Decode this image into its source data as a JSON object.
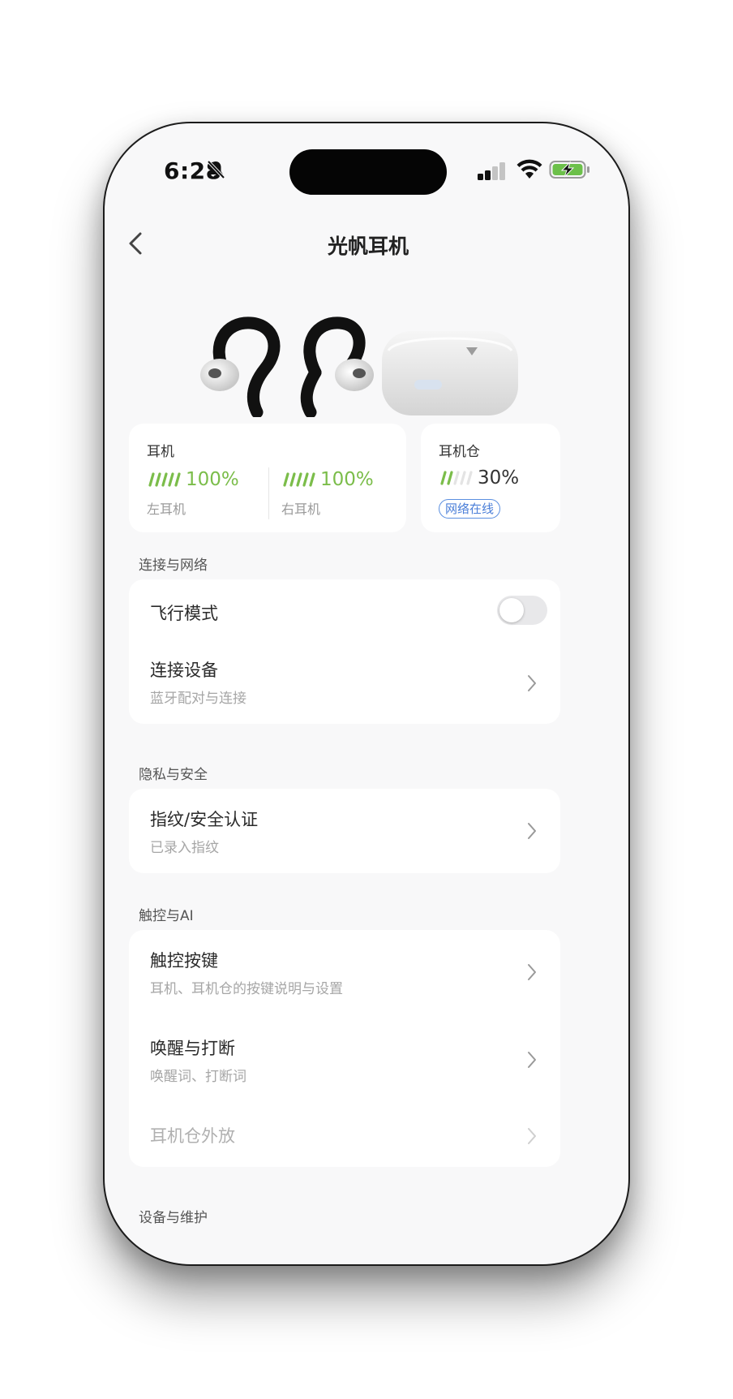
{
  "status_bar": {
    "time": "6:28"
  },
  "header": {
    "title": "光帆耳机"
  },
  "battery": {
    "earbuds": {
      "label": "耳机",
      "left": {
        "percent": "100%",
        "label": "左耳机",
        "level": 1.0
      },
      "right": {
        "percent": "100%",
        "label": "右耳机",
        "level": 1.0
      }
    },
    "case": {
      "label": "耳机仓",
      "percent": "30%",
      "level": 0.3,
      "badge": "网络在线"
    }
  },
  "sections": {
    "connectivity": {
      "label": "连接与网络",
      "airplane": {
        "title": "飞行模式",
        "enabled": false
      },
      "connect": {
        "title": "连接设备",
        "subtitle": "蓝牙配对与连接"
      }
    },
    "privacy": {
      "label": "隐私与安全",
      "fingerprint": {
        "title": "指纹/安全认证",
        "subtitle": "已录入指纹"
      }
    },
    "touch_ai": {
      "label": "触控与AI",
      "touch_keys": {
        "title": "触控按键",
        "subtitle": "耳机、耳机仓的按键说明与设置"
      },
      "wake": {
        "title": "唤醒与打断",
        "subtitle": "唤醒词、打断词"
      },
      "case_speaker": {
        "title": "耳机仓外放"
      }
    },
    "device": {
      "label": "设备与维护"
    }
  },
  "colors": {
    "accent_green": "#7bbd4a",
    "badge_blue": "#4a7ed8",
    "background": "#f8f8f9"
  }
}
